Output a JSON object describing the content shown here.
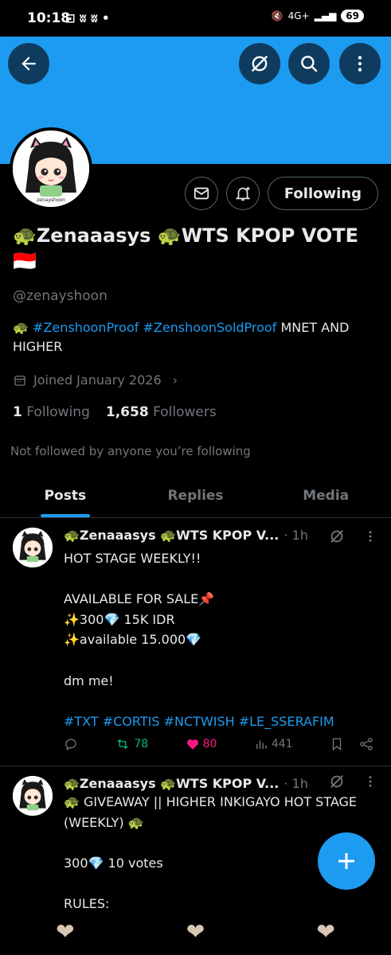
{
  "status": {
    "time": "10:18",
    "left_icons": "⊡ ʬ ʬ •",
    "signal": "4G+",
    "battery": "69"
  },
  "colors": {
    "accent": "#1d9bf0",
    "retweet": "#00ba7c",
    "like": "#f91880"
  },
  "header": {
    "back_icon": "arrow-left-icon",
    "grok_icon": "slash-circle-icon",
    "search_icon": "search-icon",
    "more_icon": "more-vertical-icon"
  },
  "profile": {
    "follow_label": "Following",
    "name": "🐢Zenaaasys 🐢WTS KPOP VOTE 🇮🇩",
    "handle": "@zenayshoon",
    "bio_prefix": "🐢 ",
    "bio_tags": "#ZenshoonProof #ZenshoonSoldProof",
    "bio_suffix": " MNET AND HIGHER",
    "joined": "Joined January 2026",
    "following_count": "1",
    "following_label": "Following",
    "followers_count": "1,658",
    "followers_label": "Followers",
    "not_followed": "Not followed by anyone you’re following"
  },
  "tabs": [
    {
      "label": "Posts"
    },
    {
      "label": "Replies"
    },
    {
      "label": "Media"
    }
  ],
  "tweets": [
    {
      "display_name": "🐢Zenaaasys 🐢WTS KPOP V...",
      "time": "· 1h",
      "text": "HOT STAGE WEEKLY!!\n\nAVAILABLE FOR SALE📌\n✨300💎 15K IDR\n✨available 15.000💎\n\ndm me!\n\n",
      "tags": "#TXT #CORTIS #NCTWISH #LE_SSERAFIM",
      "retweets": "78",
      "likes": "80",
      "views": "441"
    },
    {
      "display_name": "🐢Zenaaasys 🐢WTS KPOP V...",
      "time": "· 1h",
      "text": "🐢 GIVEAWAY || HIGHER INKIGAYO HOT STAGE (WEEKLY) 🐢\n\n300💎 10 votes\n\nRULES:"
    }
  ],
  "nav": {
    "heart_glyph": "❤"
  }
}
